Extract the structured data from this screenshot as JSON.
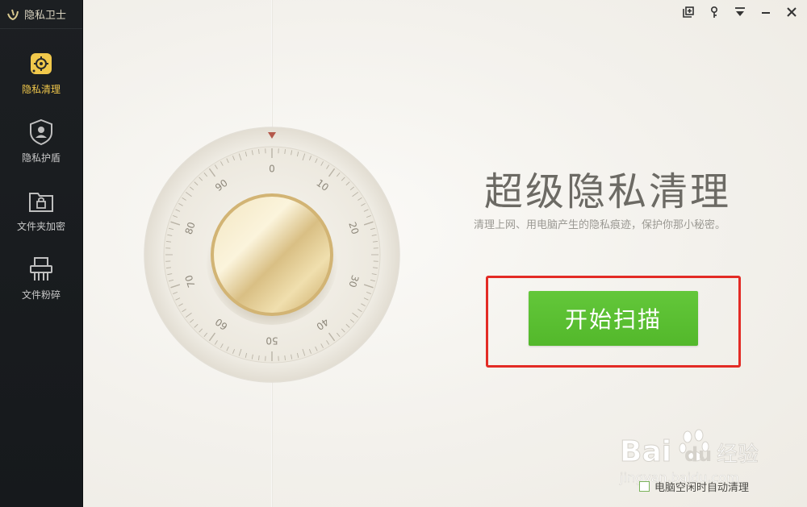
{
  "app": {
    "title": "隐私卫士"
  },
  "sidebar": {
    "items": [
      {
        "label": "隐私清理",
        "icon": "gear-icon",
        "active": true
      },
      {
        "label": "隐私护盾",
        "icon": "shield-icon",
        "active": false
      },
      {
        "label": "文件夹加密",
        "icon": "lock-folder-icon",
        "active": false
      },
      {
        "label": "文件粉碎",
        "icon": "shredder-icon",
        "active": false
      }
    ]
  },
  "window_controls": [
    "add-icon",
    "pin-icon",
    "menu-icon",
    "minimize-icon",
    "close-icon"
  ],
  "dial": {
    "ticks": [
      "0",
      "10",
      "20",
      "30",
      "40",
      "50",
      "60",
      "70",
      "80",
      "90"
    ]
  },
  "main": {
    "headline": "超级隐私清理",
    "subline": "清理上网、用电脑产生的隐私痕迹，保护你那小秘密。",
    "start_button": "开始扫描",
    "auto_clean_label": "电脑空闲时自动清理",
    "auto_clean_checked": false
  },
  "watermark": {
    "brand": "Bai",
    "brand2": "du",
    "suffix": "经验",
    "url": "jingyan.baidu.com"
  },
  "colors": {
    "accent_green": "#5bbf33",
    "highlight_red": "#e32b25",
    "sidebar_active": "#f1c84b"
  }
}
